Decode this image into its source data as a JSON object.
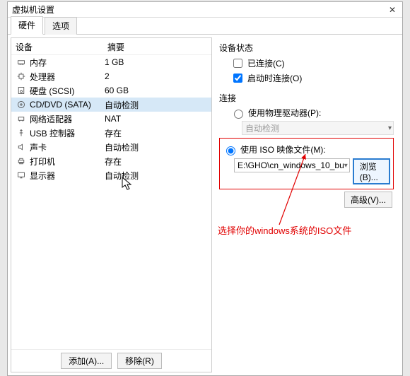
{
  "window": {
    "title": "虚拟机设置"
  },
  "tabs": {
    "hardware": "硬件",
    "options": "选项"
  },
  "columns": {
    "device": "设备",
    "summary": "摘要"
  },
  "rows": [
    {
      "icon": "memory",
      "label": "内存",
      "summary": "1 GB"
    },
    {
      "icon": "cpu",
      "label": "处理器",
      "summary": "2"
    },
    {
      "icon": "disk",
      "label": "硬盘 (SCSI)",
      "summary": "60 GB"
    },
    {
      "icon": "cd",
      "label": "CD/DVD (SATA)",
      "summary": "自动检测"
    },
    {
      "icon": "net",
      "label": "网络适配器",
      "summary": "NAT"
    },
    {
      "icon": "usb",
      "label": "USB 控制器",
      "summary": "存在"
    },
    {
      "icon": "sound",
      "label": "声卡",
      "summary": "自动检测"
    },
    {
      "icon": "printer",
      "label": "打印机",
      "summary": "存在"
    },
    {
      "icon": "display",
      "label": "显示器",
      "summary": "自动检测"
    }
  ],
  "selectedRow": 3,
  "buttons": {
    "add": "添加(A)...",
    "remove": "移除(R)"
  },
  "status": {
    "group": "设备状态",
    "connected": {
      "label": "已连接(C)",
      "checked": false
    },
    "connectAtPower": {
      "label": "启动时连接(O)",
      "checked": true
    }
  },
  "connection": {
    "group": "连接",
    "physical": {
      "label": "使用物理驱动器(P):",
      "selected": false,
      "value": "自动检测"
    },
    "iso": {
      "label": "使用 ISO 映像文件(M):",
      "selected": true,
      "value": "E:\\GHO\\cn_windows_10_bu"
    },
    "browse": "浏览(B)..."
  },
  "advanced": "高级(V)...",
  "annotation": "选择你的windows系统的ISO文件"
}
